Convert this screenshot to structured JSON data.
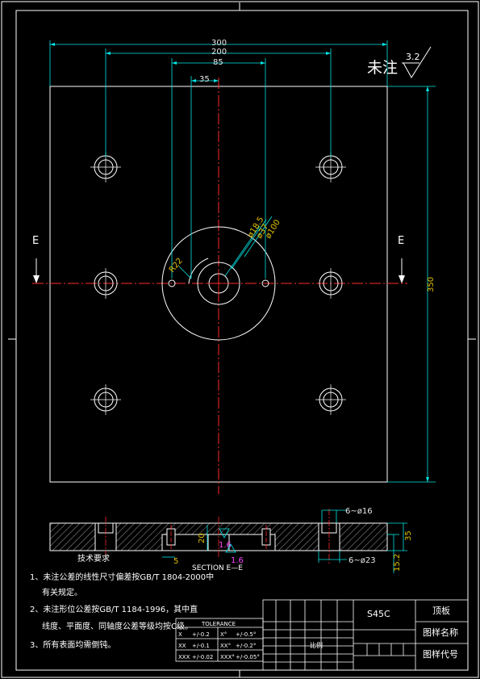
{
  "title_block": {
    "material": "S45C",
    "part_name": "顶板",
    "drawing_name_label": "图样名称",
    "drawing_code_label": "图样代号",
    "scale_label": "比例"
  },
  "surface_note": {
    "label": "未注",
    "roughness": "3.2"
  },
  "plan_view": {
    "dims": {
      "w300": "300",
      "w200": "200",
      "w85": "85",
      "w35": "35",
      "h350": "350",
      "d18": "ø18.5",
      "d37": "ø37",
      "d100": "ø100",
      "r22": "R22"
    },
    "section_label_left": "E",
    "section_label_right": "E"
  },
  "section_view": {
    "dims": {
      "d16": "6~ø16",
      "d23": "6~ø23",
      "h35": "35",
      "h15": "15.2",
      "h20": "20",
      "w5": "5"
    },
    "roughness_a": "1.6",
    "roughness_b": "1.6",
    "caption": "SECTION  E—E"
  },
  "tech_req": {
    "heading": "技术要求",
    "items": [
      "1、未注公差的线性尺寸偏差按GB/T 1804-2000中",
      "有关规定。",
      "2、未注形位公差按GB/T 1184-1996，其中直",
      "线度、平面度、同轴度公差等级均按C级。",
      "3、所有表面均需倒钝。"
    ]
  },
  "tolerance": {
    "heading": "TOLERANCE",
    "rows": [
      [
        "X",
        "+/-0.2",
        "X°",
        "+/-0.5°"
      ],
      [
        "XX",
        "+/-0.1",
        "XX°",
        "+/-0.2°"
      ],
      [
        "XXX",
        "+/-0.02",
        "XXX°",
        "+/-0.05°"
      ]
    ]
  },
  "colors": {
    "background": "#000000",
    "outline": "#ffffff",
    "center_line": "#ff2a2a",
    "dimension": "#00e5e5",
    "dim_text": "#e0c000",
    "roughness_mark": "#ff40ff"
  }
}
